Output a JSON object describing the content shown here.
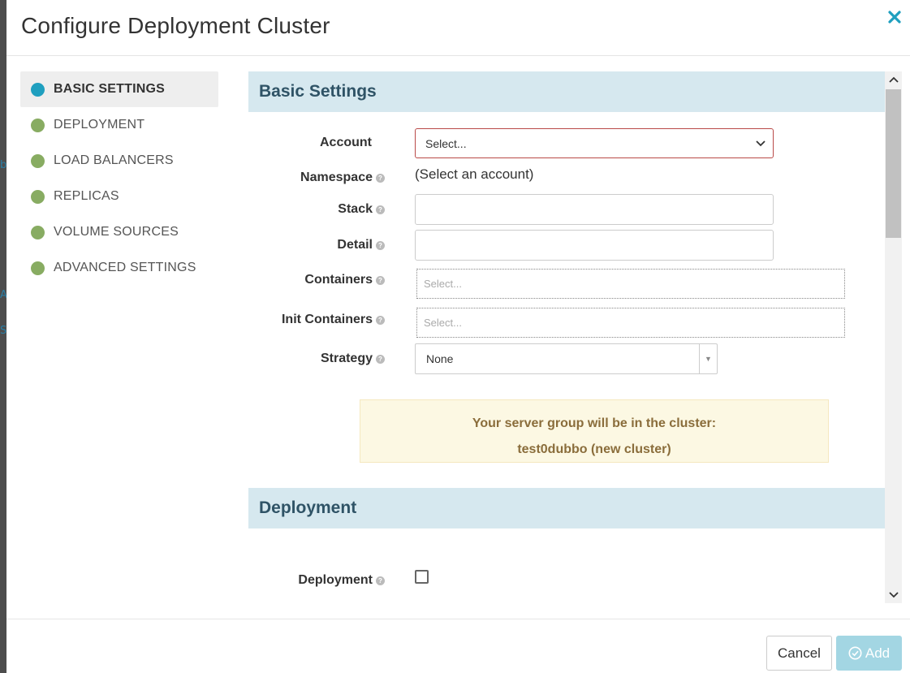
{
  "backdrop": {
    "ghost_chars": [
      "b",
      "A",
      "S"
    ]
  },
  "modal": {
    "title": "Configure Deployment Cluster",
    "close_icon": "close-icon"
  },
  "sidebar": {
    "items": [
      {
        "label": "BASIC SETTINGS",
        "active": true
      },
      {
        "label": "DEPLOYMENT",
        "active": false
      },
      {
        "label": "LOAD BALANCERS",
        "active": false
      },
      {
        "label": "REPLICAS",
        "active": false
      },
      {
        "label": "VOLUME SOURCES",
        "active": false
      },
      {
        "label": "ADVANCED SETTINGS",
        "active": false
      }
    ]
  },
  "basic_settings": {
    "title": "Basic Settings",
    "account": {
      "label": "Account",
      "value": "Select..."
    },
    "namespace": {
      "label": "Namespace",
      "value": "(Select an account)"
    },
    "stack": {
      "label": "Stack",
      "value": ""
    },
    "detail": {
      "label": "Detail",
      "value": ""
    },
    "containers": {
      "label": "Containers",
      "placeholder": "Select..."
    },
    "init_containers": {
      "label": "Init Containers",
      "placeholder": "Select..."
    },
    "strategy": {
      "label": "Strategy",
      "value": "None"
    },
    "notice": {
      "line1": "Your server group will be in the cluster:",
      "line2": "test0dubbo (new cluster)"
    }
  },
  "deployment": {
    "title": "Deployment",
    "deployment_field": {
      "label": "Deployment",
      "checked": false
    }
  },
  "footer": {
    "cancel_label": "Cancel",
    "add_label": "Add"
  },
  "colors": {
    "section_bg": "#d6e8ef",
    "active_dot": "#1f9fbf",
    "complete_dot": "#88ac62",
    "error_border": "#b94a48",
    "notice_bg": "#fcf8e3",
    "add_button_disabled": "#a3d6e3"
  }
}
